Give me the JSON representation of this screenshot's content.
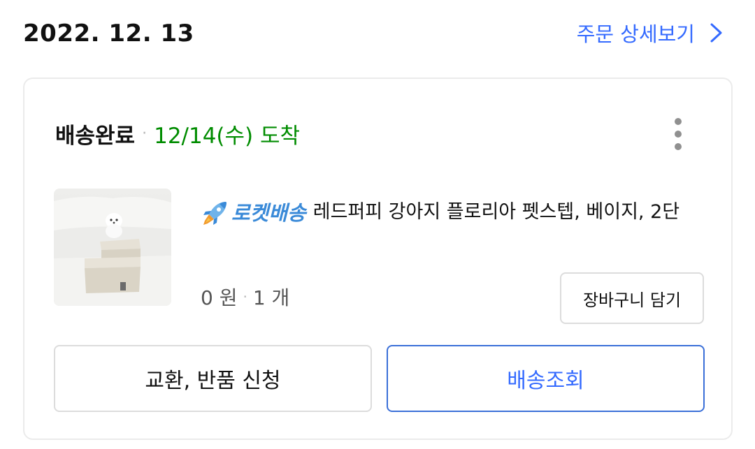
{
  "order": {
    "date": "2022. 12. 13",
    "detail_link_label": "주문 상세보기"
  },
  "shipment": {
    "status": "배송완료",
    "separator": "·",
    "arrival": "12/14(수) 도착"
  },
  "product": {
    "badge_label": "로켓배송",
    "name": "레드퍼피 강아지 플로리아 펫스텝, 베이지, 2단",
    "price": "0 원",
    "quantity": "1 개",
    "separator": "·"
  },
  "buttons": {
    "add_to_cart": "장바구니 담기",
    "exchange_return": "교환, 반품 신청",
    "track_delivery": "배송조회"
  },
  "colors": {
    "link_blue": "#346aff",
    "arrival_green": "#008c00",
    "rocket_blue": "#3a8ad8"
  },
  "icons": {
    "detail_chevron": "chevron-right-icon",
    "more_menu": "kebab-menu-icon",
    "rocket": "rocket-icon"
  }
}
